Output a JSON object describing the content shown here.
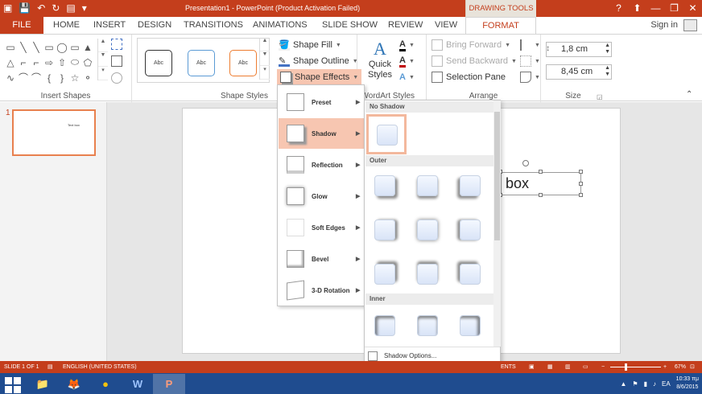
{
  "title_bar": {
    "title": "Presentation1 - PowerPoint (Product Activation Failed)",
    "context_tab": "DRAWING TOOLS",
    "window_buttons": [
      "?",
      "⬆",
      "—",
      "❐",
      "✕"
    ]
  },
  "tabs": {
    "file": "FILE",
    "items": [
      "HOME",
      "INSERT",
      "DESIGN",
      "TRANSITIONS",
      "ANIMATIONS",
      "SLIDE SHOW",
      "REVIEW",
      "VIEW"
    ],
    "format": "FORMAT",
    "sign_in": "Sign in"
  },
  "ribbon": {
    "insert_shapes": {
      "label": "Insert Shapes",
      "shapes": [
        "▭",
        "╲",
        "╲",
        "▭",
        "◯",
        "▭",
        "▲",
        "△",
        "⌐",
        "⌐",
        "⇨",
        "⇧",
        "⬭",
        "⬠",
        "∿",
        "⌒",
        "⌒",
        "{",
        "}",
        "☆",
        "⚬"
      ]
    },
    "shape_styles": {
      "label": "Shape Styles",
      "samples": [
        "Abc",
        "Abc",
        "Abc"
      ],
      "colors": [
        "#333333",
        "#5b9bd5",
        "#ed7d31"
      ],
      "shape_fill": "Shape Fill",
      "shape_outline": "Shape Outline",
      "shape_effects": "Shape Effects"
    },
    "wordart": {
      "label": "WordArt Styles",
      "quick_styles_1": "Quick",
      "quick_styles_2": "Styles"
    },
    "arrange": {
      "label": "Arrange",
      "bring_forward": "Bring Forward",
      "send_backward": "Send Backward",
      "selection_pane": "Selection Pane"
    },
    "size": {
      "label": "Size",
      "height": "1,8 cm",
      "width": "8,45 cm"
    }
  },
  "thumbnail": {
    "number": "1",
    "text": "Text box"
  },
  "slide": {
    "textbox": "box"
  },
  "effects_menu": {
    "items": [
      {
        "label": "Preset",
        "active": false
      },
      {
        "label": "Shadow",
        "active": true
      },
      {
        "label": "Reflection",
        "active": false
      },
      {
        "label": "Glow",
        "active": false
      },
      {
        "label": "Soft Edges",
        "active": false
      },
      {
        "label": "Bevel",
        "active": false
      },
      {
        "label": "3-D Rotation",
        "active": false
      }
    ]
  },
  "shadow_panel": {
    "sections": {
      "none": "No Shadow",
      "outer": "Outer",
      "inner": "Inner"
    },
    "options": "Shadow Options..."
  },
  "status": {
    "slide": "SLIDE 1 OF 1",
    "language": "ENGLISH (UNITED STATES)",
    "comments": "ENTS",
    "zoom": "67%"
  },
  "taskbar": {
    "apps": [
      "📁",
      "🦊",
      "●",
      "W",
      "P"
    ],
    "lang": "EA",
    "time": "10:33 πμ",
    "date": "8/6/2015"
  },
  "colors": {
    "accent": "#c43e1c",
    "active_menu": "#f7c6b1",
    "taskbar": "#1f4c8f"
  }
}
